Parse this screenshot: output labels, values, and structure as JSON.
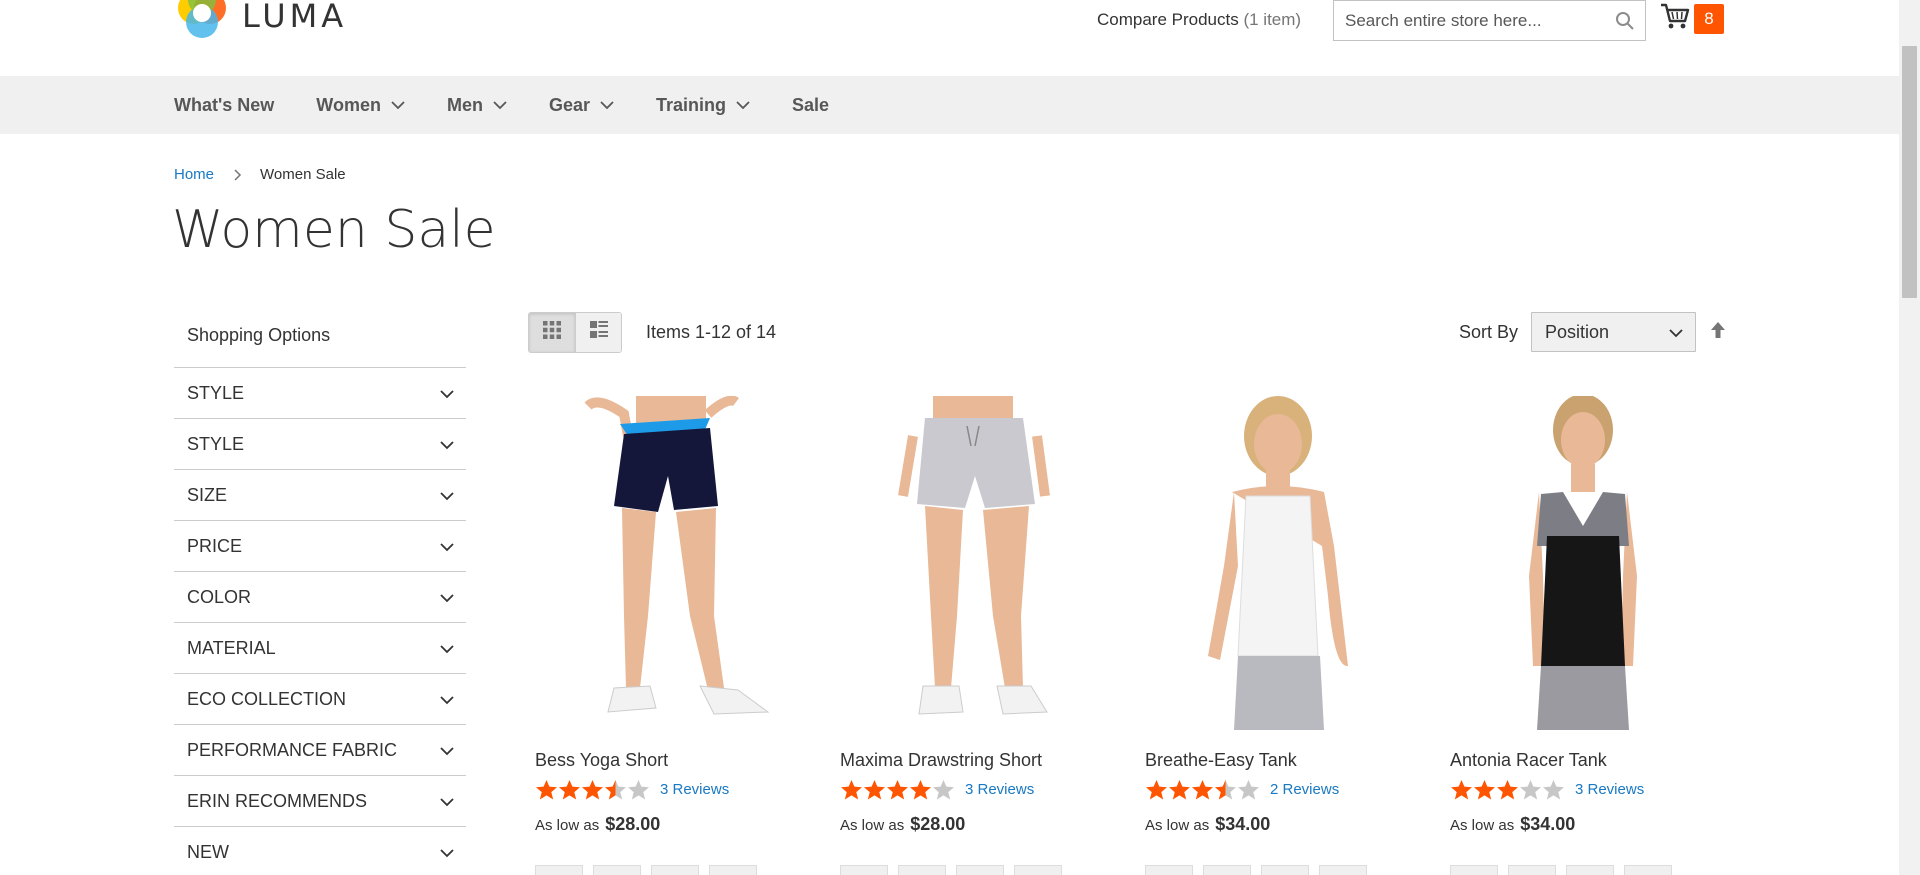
{
  "header": {
    "logo_text": "LUMA",
    "compare_label": "Compare Products",
    "compare_count": "(1 item)",
    "search_placeholder": "Search entire store here...",
    "cart_count": "8",
    "icons": {
      "search": "search-icon",
      "cart": "cart-icon"
    },
    "colors": {
      "accent": "#ff5501",
      "link": "#1979c3"
    }
  },
  "nav": {
    "items": [
      {
        "label": "What's New",
        "has_dropdown": false
      },
      {
        "label": "Women",
        "has_dropdown": true
      },
      {
        "label": "Men",
        "has_dropdown": true
      },
      {
        "label": "Gear",
        "has_dropdown": true
      },
      {
        "label": "Training",
        "has_dropdown": true
      },
      {
        "label": "Sale",
        "has_dropdown": false
      }
    ]
  },
  "breadcrumb": {
    "home": "Home",
    "current": "Women Sale"
  },
  "page_title": "Women Sale",
  "sidebar": {
    "title": "Shopping Options",
    "filters": [
      "STYLE",
      "STYLE",
      "SIZE",
      "PRICE",
      "COLOR",
      "MATERIAL",
      "ECO COLLECTION",
      "PERFORMANCE FABRIC",
      "ERIN RECOMMENDS",
      "NEW"
    ]
  },
  "toolbar": {
    "modes": [
      "grid",
      "list"
    ],
    "active_mode": "grid",
    "amount": "Items 1-12 of 14",
    "sort_label": "Sort By",
    "sort_value": "Position",
    "sort_direction": "ascending"
  },
  "products": [
    {
      "name": "Bess Yoga Short",
      "rating": 3.5,
      "reviews": "3 Reviews",
      "price_label": "As low as",
      "price": "$28.00"
    },
    {
      "name": "Maxima Drawstring Short",
      "rating": 4,
      "reviews": "3 Reviews",
      "price_label": "As low as",
      "price": "$28.00"
    },
    {
      "name": "Breathe-Easy Tank",
      "rating": 3.5,
      "reviews": "2 Reviews",
      "price_label": "As low as",
      "price": "$34.00"
    },
    {
      "name": "Antonia Racer Tank",
      "rating": 3,
      "reviews": "3 Reviews",
      "price_label": "As low as",
      "price": "$34.00"
    }
  ]
}
